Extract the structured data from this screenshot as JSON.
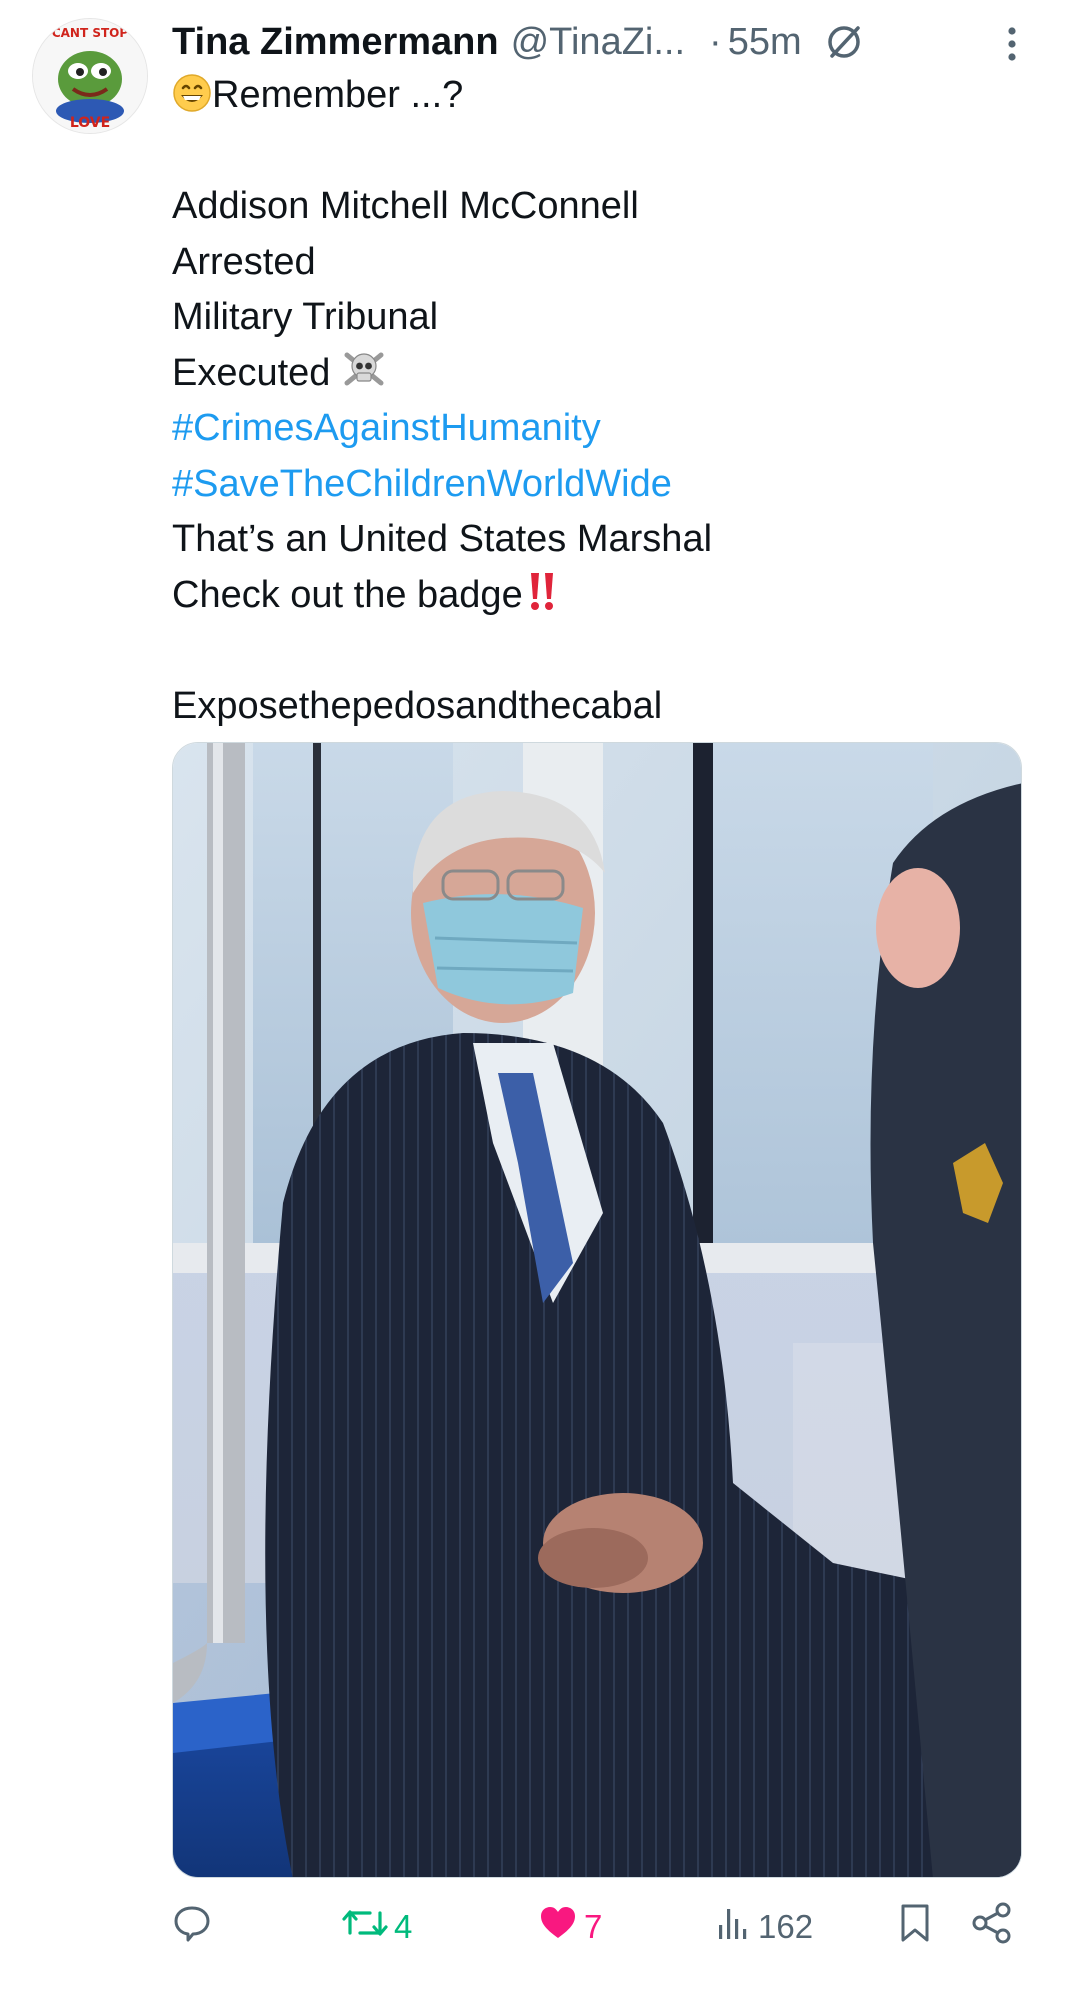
{
  "post": {
    "author": {
      "display_name": "Tina Zimmermann",
      "handle": "@TinaZi...",
      "avatar_text_top": "CANT STOP",
      "avatar_text_bottom": "LOVE"
    },
    "separator": "·",
    "timestamp": "55m",
    "status_icon": "slashed-circle-icon",
    "more_icon": "vertical-ellipsis-icon",
    "text": {
      "first_line": "Remember ...?",
      "lines": [
        "Addison Mitchell McConnell",
        "Arrested",
        "Military Tribunal",
        "Executed"
      ],
      "hashtags": [
        "#CrimesAgainstHumanity",
        "#SaveTheChildrenWorldWide"
      ],
      "line_marshal": "That’s an United States Marshal",
      "line_badge": "Check out the badge",
      "closing": "Exposethepedosandthecabal"
    },
    "media": {
      "kind": "photo",
      "icon": "photo-of-man-in-face-mask-on-train-icon"
    },
    "actions": {
      "reply": {
        "icon": "reply-icon",
        "count": ""
      },
      "retweet": {
        "icon": "retweet-icon",
        "count": "4",
        "color": "#00ba7c"
      },
      "like": {
        "icon": "heart-icon",
        "count": "7",
        "color": "#f91880"
      },
      "views": {
        "icon": "views-icon",
        "count": "162"
      },
      "bookmark": {
        "icon": "bookmark-icon"
      },
      "share": {
        "icon": "share-icon"
      }
    }
  }
}
